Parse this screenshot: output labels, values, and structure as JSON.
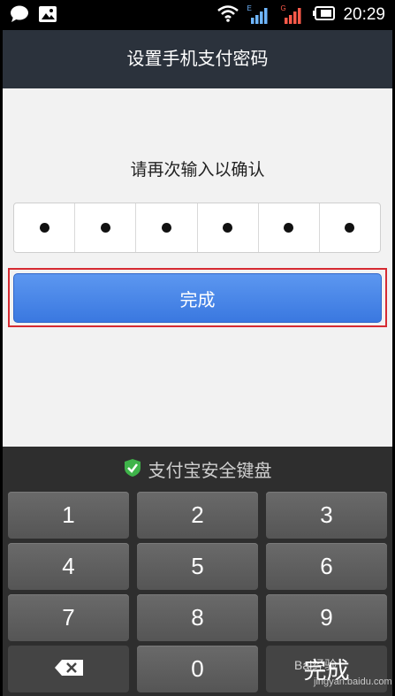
{
  "status_bar": {
    "time": "20:29",
    "sim1_label": "E",
    "sim2_label": "G",
    "icons": [
      "message-bubble-icon",
      "image-icon",
      "wifi-icon",
      "signal-icon",
      "signal-icon",
      "battery-icon"
    ]
  },
  "header": {
    "title": "设置手机支付密码"
  },
  "main": {
    "prompt": "请再次输入以确认",
    "pin_digits_entered": 6,
    "done_label": "完成"
  },
  "keyboard": {
    "title": "支付宝安全键盘",
    "keys": [
      "1",
      "2",
      "3",
      "4",
      "5",
      "6",
      "7",
      "8",
      "9",
      "0"
    ],
    "done_label": "完成",
    "watermark": "Bai经验",
    "watermark_url": "jingyan.baidu.com"
  },
  "colors": {
    "title_bar": "#2b323c",
    "primary_button": "#4a86e8",
    "highlight_border": "#d62b32",
    "shield_green": "#3fb44a",
    "keyboard_bg": "#2e2e2e"
  }
}
